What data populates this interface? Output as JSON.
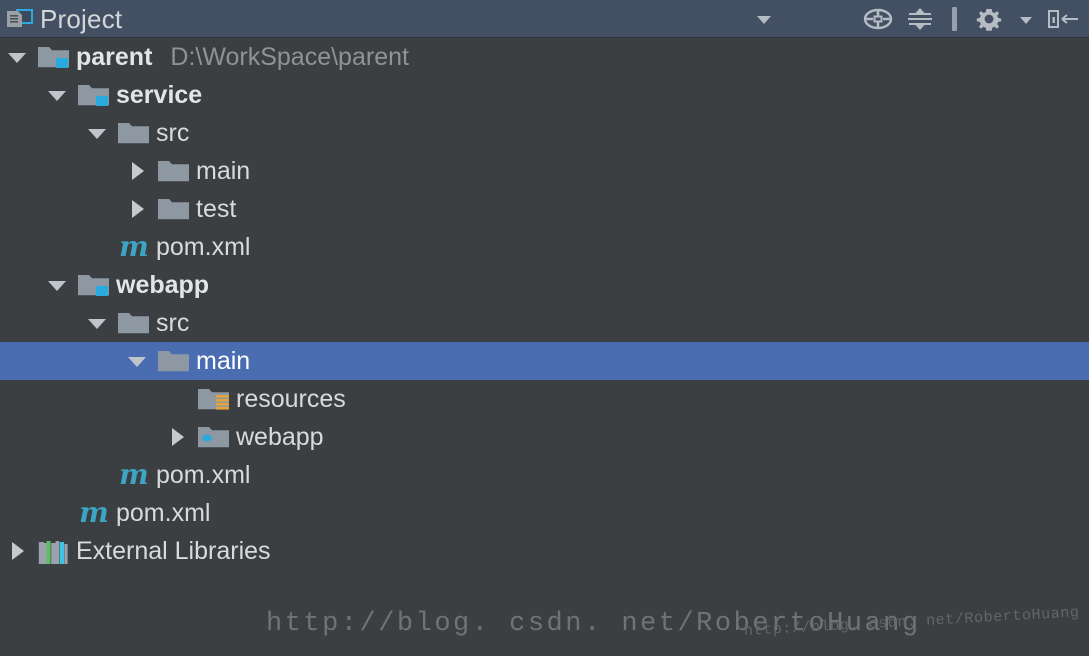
{
  "window": {
    "title": "Project",
    "icon": "project-view-icon",
    "background": "#3c3f41",
    "titlebar_background": "#434f62",
    "selection_color": "#4a6cb0"
  },
  "toolbar": {
    "buttons": [
      {
        "name": "view-options-dropdown",
        "icon": "chevron-down-icon",
        "label": ""
      },
      {
        "name": "scroll-from-source-button",
        "icon": "locate-target-icon",
        "label": ""
      },
      {
        "name": "collapse-all-button",
        "icon": "collapse-all-icon",
        "label": ""
      },
      {
        "name": "settings-button",
        "icon": "gear-icon",
        "label": ""
      },
      {
        "name": "settings-dropdown-arrow",
        "icon": "chevron-down-small-icon",
        "label": ""
      },
      {
        "name": "hide-panel-button",
        "icon": "hide-left-icon",
        "label": ""
      }
    ]
  },
  "tree": {
    "nodes": [
      {
        "label": "parent",
        "path": "D:\\WorkSpace\\parent",
        "icon": "module-folder-icon",
        "toggle": "expanded",
        "depth": 0,
        "bold": true,
        "selected": false
      },
      {
        "label": "service",
        "path": "",
        "icon": "module-folder-icon",
        "toggle": "expanded",
        "depth": 1,
        "bold": true,
        "selected": false
      },
      {
        "label": "src",
        "path": "",
        "icon": "folder-icon",
        "toggle": "expanded",
        "depth": 2,
        "bold": false,
        "selected": false
      },
      {
        "label": "main",
        "path": "",
        "icon": "folder-icon",
        "toggle": "collapsed",
        "depth": 3,
        "bold": false,
        "selected": false
      },
      {
        "label": "test",
        "path": "",
        "icon": "folder-icon",
        "toggle": "collapsed",
        "depth": 3,
        "bold": false,
        "selected": false
      },
      {
        "label": "pom.xml",
        "path": "",
        "icon": "maven-pom-icon",
        "toggle": "none",
        "depth": 2,
        "bold": false,
        "selected": false
      },
      {
        "label": "webapp",
        "path": "",
        "icon": "module-folder-icon",
        "toggle": "expanded",
        "depth": 1,
        "bold": true,
        "selected": false
      },
      {
        "label": "src",
        "path": "",
        "icon": "folder-icon",
        "toggle": "expanded",
        "depth": 2,
        "bold": false,
        "selected": false
      },
      {
        "label": "main",
        "path": "",
        "icon": "folder-icon",
        "toggle": "expanded",
        "depth": 3,
        "bold": false,
        "selected": true
      },
      {
        "label": "resources",
        "path": "",
        "icon": "resources-folder-icon",
        "toggle": "none",
        "depth": 4,
        "bold": false,
        "selected": false
      },
      {
        "label": "webapp",
        "path": "",
        "icon": "web-folder-icon",
        "toggle": "collapsed",
        "depth": 4,
        "bold": false,
        "selected": false
      },
      {
        "label": "pom.xml",
        "path": "",
        "icon": "maven-pom-icon",
        "toggle": "none",
        "depth": 2,
        "bold": false,
        "selected": false
      },
      {
        "label": "pom.xml",
        "path": "",
        "icon": "maven-pom-icon",
        "toggle": "none",
        "depth": 1,
        "bold": false,
        "selected": false
      },
      {
        "label": "External Libraries",
        "path": "",
        "icon": "external-libraries-icon",
        "toggle": "collapsed",
        "depth": 0,
        "bold": false,
        "selected": false
      }
    ]
  },
  "watermarks": {
    "main": "http://blog. csdn. net/RobertoHuang",
    "overlay": "http://blog. csdn. net/RobertoHuang"
  }
}
